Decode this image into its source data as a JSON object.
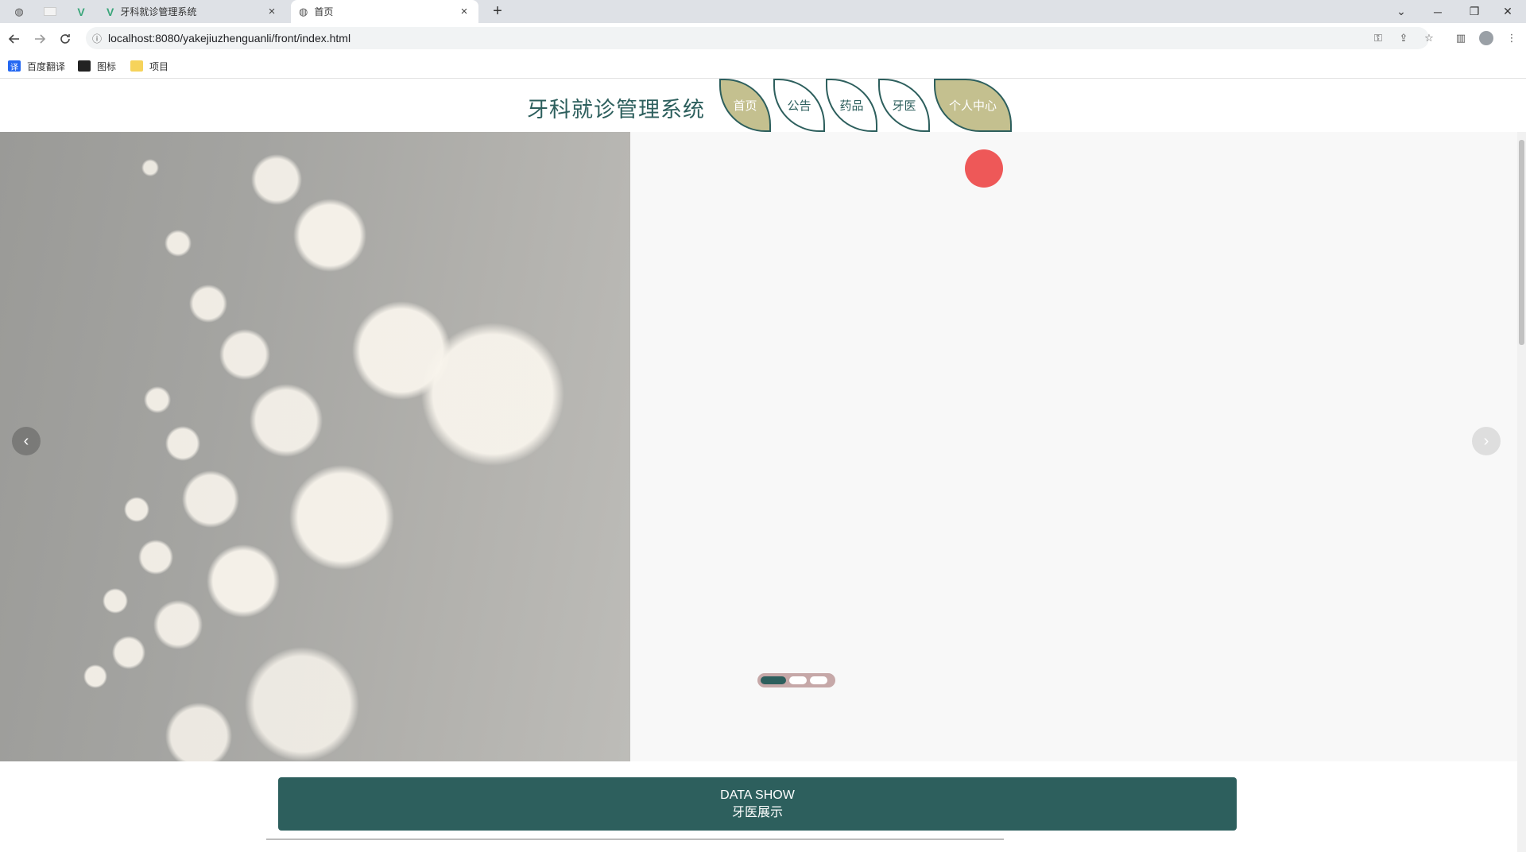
{
  "browser": {
    "tabs": [
      {
        "label": "牙科就诊管理系统",
        "close": "×",
        "active": false
      },
      {
        "label": "首页",
        "close": "×",
        "active": true
      }
    ],
    "new_tab": "+",
    "url": "localhost:8080/yakejiuzhenguanli/front/index.html",
    "bookmarks": [
      {
        "label": "百度翻译",
        "icon": "translate-icon",
        "badge": "译"
      },
      {
        "label": "图标",
        "icon": "image-icon"
      },
      {
        "label": "项目",
        "icon": "folder-icon"
      }
    ],
    "controls": {
      "minimize": "─",
      "restore": "❐",
      "close": "✕",
      "tab_search": "⌄"
    }
  },
  "site": {
    "title": "牙科就诊管理系统",
    "nav": [
      {
        "label": "首页",
        "active": true
      },
      {
        "label": "公告",
        "active": false
      },
      {
        "label": "药品",
        "active": false
      },
      {
        "label": "牙医",
        "active": false
      },
      {
        "label": "个人中心",
        "active": true
      }
    ]
  },
  "carousel": {
    "prev": "‹",
    "next": "›",
    "slide_count": 3,
    "active_index": 0
  },
  "section": {
    "title_en": "DATA SHOW",
    "title_cn": "牙医展示"
  },
  "colors": {
    "primary": "#2d5f5d",
    "accent": "#c4c08f",
    "indicator_track": "#c6a8a8"
  }
}
